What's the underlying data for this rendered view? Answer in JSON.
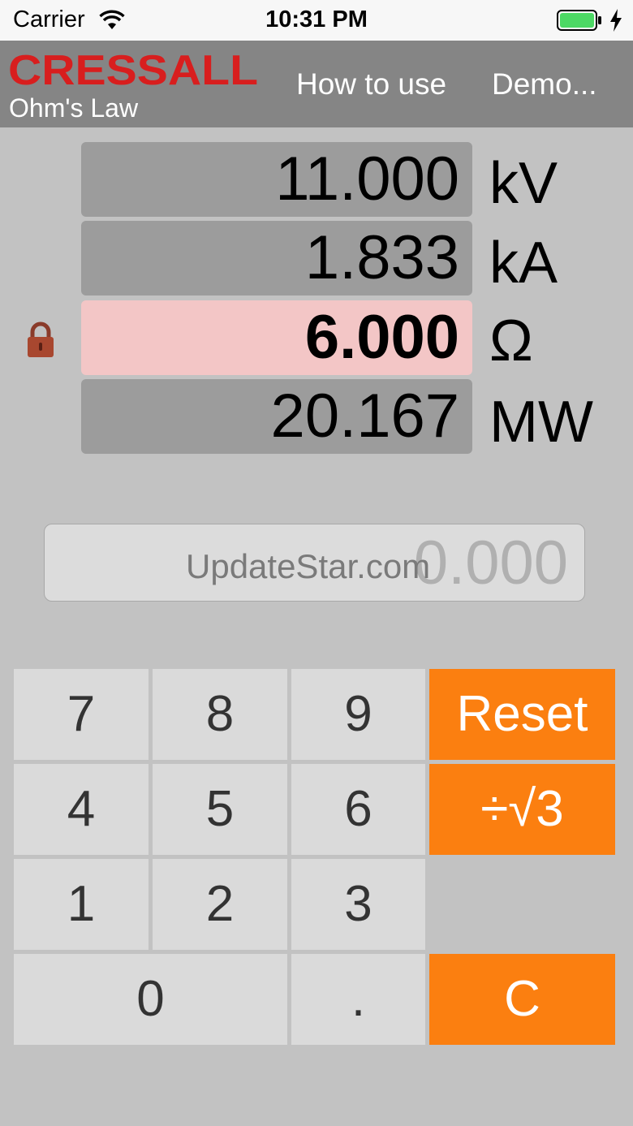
{
  "status_bar": {
    "carrier": "Carrier",
    "time": "10:31 PM",
    "battery_color": "#4cd964"
  },
  "header": {
    "brand": "CRESSALL",
    "brand_color": "#d81e1e",
    "subtitle": "Ohm's Law",
    "nav": {
      "how_to_use": "How to use",
      "demo": "Demo..."
    }
  },
  "values": [
    {
      "value": "11.000",
      "unit": "kV",
      "locked": false
    },
    {
      "value": "1.833",
      "unit": "kA",
      "locked": false
    },
    {
      "value": "6.000",
      "unit": "Ω",
      "locked": true
    },
    {
      "value": "20.167",
      "unit": "MW",
      "locked": false
    }
  ],
  "entry": {
    "value": "0.000",
    "watermark": "UpdateStar.com"
  },
  "keypad": {
    "k7": "7",
    "k8": "8",
    "k9": "9",
    "reset": "Reset",
    "k4": "4",
    "k5": "5",
    "k6": "6",
    "div_sqrt3": "÷√3",
    "k1": "1",
    "k2": "2",
    "k3": "3",
    "k0": "0",
    "dot": ".",
    "clear": "C"
  },
  "colors": {
    "accent_orange": "#fb7f10",
    "locked_field": "#f3c6c6",
    "header_bg": "#858585"
  }
}
